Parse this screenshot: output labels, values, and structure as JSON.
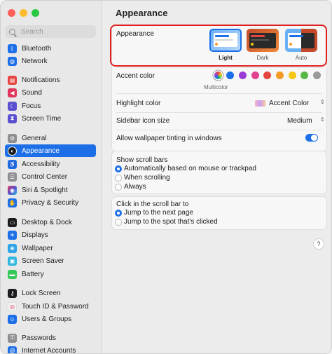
{
  "search": {
    "placeholder": "Search"
  },
  "sidebar": {
    "items": [
      {
        "label": "Bluetooth",
        "icon": "bluetooth-icon",
        "color": "#1d6fe8",
        "glyph": "ᛒ"
      },
      {
        "label": "Network",
        "icon": "globe-icon",
        "color": "#1d6fe8",
        "glyph": "◍"
      },
      {
        "label": "Notifications",
        "icon": "notifications-icon",
        "color": "#e5453f",
        "glyph": "▤"
      },
      {
        "label": "Sound",
        "icon": "speaker-icon",
        "color": "#e0365a",
        "glyph": "◀"
      },
      {
        "label": "Focus",
        "icon": "moon-icon",
        "color": "#5a4fcf",
        "glyph": "☾"
      },
      {
        "label": "Screen Time",
        "icon": "hourglass-icon",
        "color": "#5a4fcf",
        "glyph": "⧗"
      },
      {
        "label": "General",
        "icon": "gear-icon",
        "color": "#8e8e93",
        "glyph": "⚙"
      },
      {
        "label": "Appearance",
        "icon": "appearance-icon",
        "color": "#1c1c1e",
        "glyph": "◐"
      },
      {
        "label": "Accessibility",
        "icon": "accessibility-icon",
        "color": "#1d6fe8",
        "glyph": "♿"
      },
      {
        "label": "Control Center",
        "icon": "control-center-icon",
        "color": "#8e8e93",
        "glyph": "☰"
      },
      {
        "label": "Siri & Spotlight",
        "icon": "siri-icon",
        "color": "#b03be0",
        "glyph": "◉"
      },
      {
        "label": "Privacy & Security",
        "icon": "hand-icon",
        "color": "#1d6fe8",
        "glyph": "✋"
      },
      {
        "label": "Desktop & Dock",
        "icon": "dock-icon",
        "color": "#1c1c1e",
        "glyph": "▭"
      },
      {
        "label": "Displays",
        "icon": "sun-icon",
        "color": "#1d6fe8",
        "glyph": "☀"
      },
      {
        "label": "Wallpaper",
        "icon": "wallpaper-icon",
        "color": "#2fa4e7",
        "glyph": "❀"
      },
      {
        "label": "Screen Saver",
        "icon": "screen-saver-icon",
        "color": "#2fb7e0",
        "glyph": "▣"
      },
      {
        "label": "Battery",
        "icon": "battery-icon",
        "color": "#34c759",
        "glyph": "▬"
      },
      {
        "label": "Lock Screen",
        "icon": "lock-icon",
        "color": "#1c1c1e",
        "glyph": "🔒"
      },
      {
        "label": "Touch ID & Password",
        "icon": "fingerprint-icon",
        "color": "#f2f2f2",
        "glyph": "◎"
      },
      {
        "label": "Users & Groups",
        "icon": "users-icon",
        "color": "#1d6fe8",
        "glyph": "👥"
      },
      {
        "label": "Passwords",
        "icon": "key-icon",
        "color": "#8e8e93",
        "glyph": "⚿"
      },
      {
        "label": "Internet Accounts",
        "icon": "at-icon",
        "color": "#1d6fe8",
        "glyph": "@"
      }
    ]
  },
  "main": {
    "title": "Appearance",
    "appearance": {
      "label": "Appearance",
      "options": [
        {
          "label": "Light",
          "selected": true
        },
        {
          "label": "Dark",
          "selected": false
        },
        {
          "label": "Auto",
          "selected": false
        }
      ]
    },
    "accent": {
      "label": "Accent color",
      "selected_name": "Multicolor",
      "colors": [
        "#c06cf0",
        "#1d6fe8",
        "#9b3bd6",
        "#e2408f",
        "#e5453f",
        "#f59a23",
        "#f5c518",
        "#5ab946",
        "#9a9a9a"
      ]
    },
    "highlight": {
      "label": "Highlight color",
      "value": "Accent Color"
    },
    "sidebar_icon": {
      "label": "Sidebar icon size",
      "value": "Medium"
    },
    "tinting": {
      "label": "Allow wallpaper tinting in windows",
      "enabled": true
    },
    "scrollbars": {
      "label": "Show scroll bars",
      "options": [
        {
          "label": "Automatically based on mouse or trackpad",
          "selected": true
        },
        {
          "label": "When scrolling",
          "selected": false
        },
        {
          "label": "Always",
          "selected": false
        }
      ]
    },
    "click_scroll": {
      "label": "Click in the scroll bar to",
      "options": [
        {
          "label": "Jump to the next page",
          "selected": true
        },
        {
          "label": "Jump to the spot that's clicked",
          "selected": false
        }
      ]
    },
    "help": "?"
  }
}
